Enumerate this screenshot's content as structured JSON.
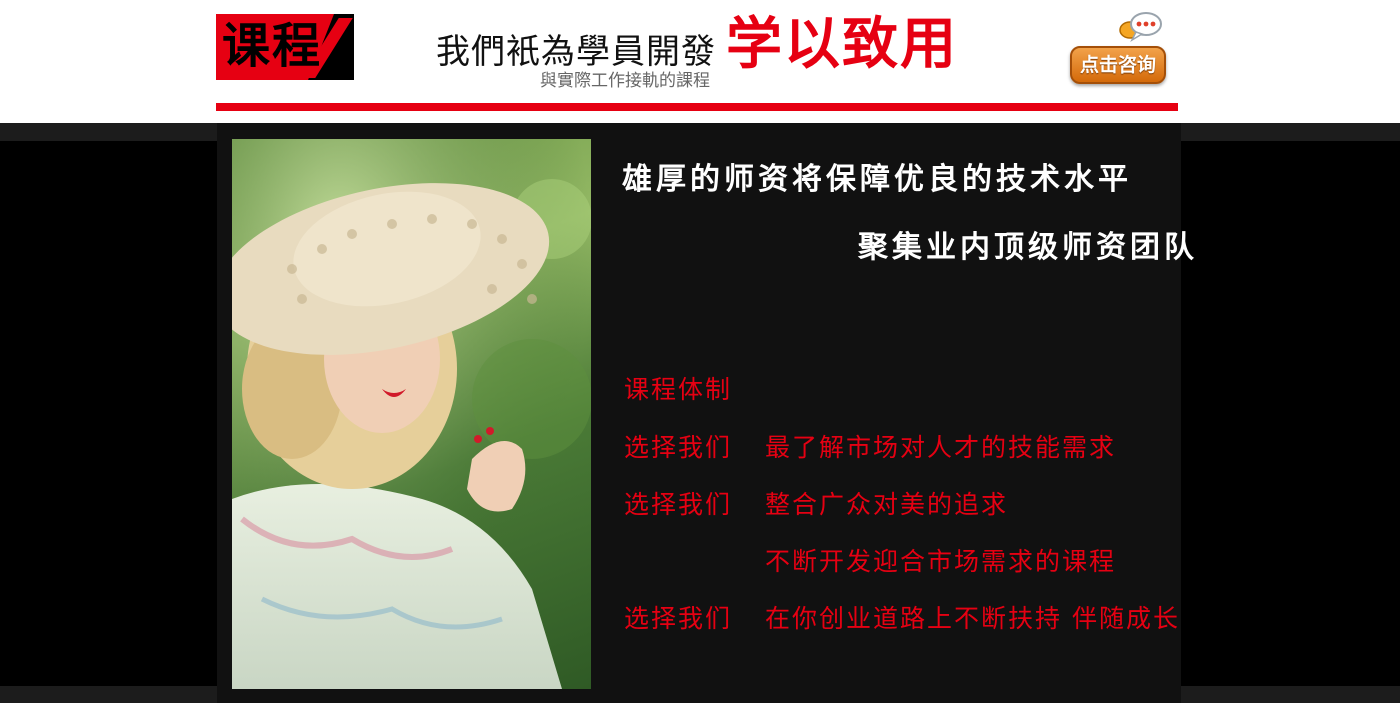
{
  "header": {
    "logo_text": "课程",
    "slogan_main": "我們衹為學員開發",
    "slogan_accent": "学以致用",
    "slogan_sub": "與實際工作接軌的課程",
    "consult_button": "点击咨询"
  },
  "colors": {
    "accent": "#e60012",
    "button": "#e07a1a",
    "panel": "#111111"
  },
  "content": {
    "photo_alt": "",
    "headline_1": "雄厚的师资将保障优良的技术水平",
    "headline_2": "聚集业内顶级师资团队",
    "section_title": "课程体制",
    "rows": [
      {
        "label": "选择我们",
        "text": "最了解市场对人才的技能需求"
      },
      {
        "label": "选择我们",
        "text": "整合广众对美的追求"
      },
      {
        "label": "",
        "text": "不断开发迎合市场需求的课程"
      },
      {
        "label": "选择我们",
        "text": "在你创业道路上不断扶持 伴随成长"
      }
    ]
  },
  "icons": {
    "chat": "chat-bubble-icon"
  }
}
